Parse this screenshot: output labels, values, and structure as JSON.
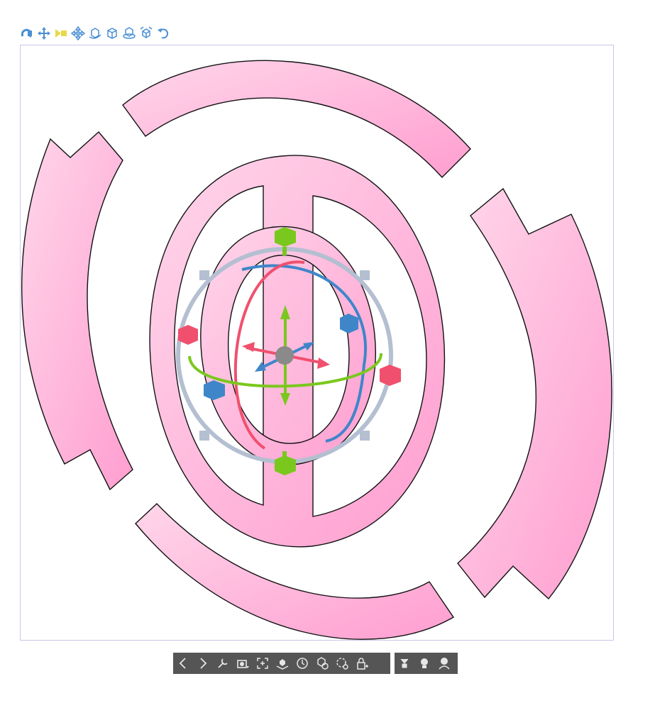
{
  "colors": {
    "ring_fill_light": "#ffd0e6",
    "ring_fill_dark": "#ff9fd0",
    "ring_stroke": "#111111",
    "toolbar_blue": "#4a8fd4",
    "toolbar_yellow": "#e8d84a",
    "gizmo_green": "#7ac81e",
    "gizmo_red": "#f0506e",
    "gizmo_blue": "#3f86c9",
    "gizmo_gray": "#b4bfd1",
    "gizmo_center": "#8a8a8a",
    "bar_bg": "#555555",
    "bar_icon": "#e6e6e6"
  },
  "top_toolbar": {
    "icons": [
      {
        "name": "rotate-camera-icon",
        "color": "blue"
      },
      {
        "name": "pan-camera-icon",
        "color": "blue"
      },
      {
        "name": "move-depth-icon",
        "color": "yellow"
      },
      {
        "name": "move-object-icon",
        "color": "blue"
      },
      {
        "name": "rotate-object-icon",
        "color": "blue"
      },
      {
        "name": "move-on-plane-icon",
        "color": "blue"
      },
      {
        "name": "rotate-on-plane-icon",
        "color": "blue"
      },
      {
        "name": "rotate-free-icon",
        "color": "blue"
      },
      {
        "name": "undo-icon",
        "color": "blue"
      }
    ]
  },
  "bottom_toolbar": {
    "main": [
      "previous-icon",
      "next-icon",
      "object-settings-icon",
      "camera-preset-icon",
      "fit-to-view-icon",
      "ground-object-icon",
      "reset-angle-icon",
      "reset-object-icon",
      "rotate-reset-icon",
      "lock-object-icon"
    ],
    "lights": [
      "light-source-1-icon",
      "light-source-2-icon",
      "light-hand-icon"
    ]
  }
}
